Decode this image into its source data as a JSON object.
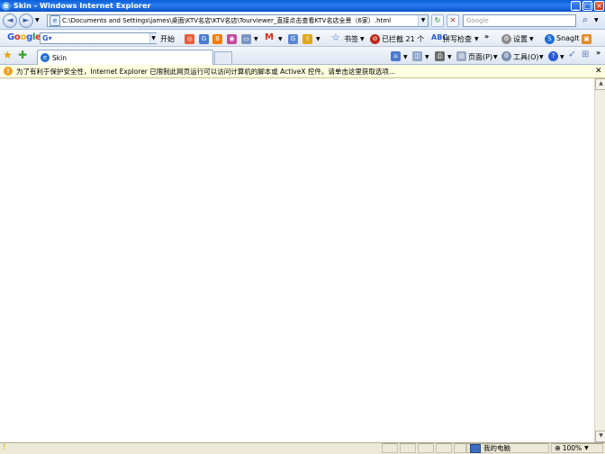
{
  "window": {
    "title": "Skin - Windows Internet Explorer",
    "controls": {
      "minimize": "_",
      "maximize": "□",
      "close": "×"
    }
  },
  "nav": {
    "back_icon": "◄",
    "forward_icon": "►",
    "address": "C:\\Documents and Settings\\james\\桌面\\KTV名店\\KTV名店\\Tourviewer_直接点击查看KTV名店全景（6家）.html",
    "search_placeholder": "Google",
    "refresh_icon": "↻",
    "stop_icon": "✕",
    "search_icon": "⌕"
  },
  "google_toolbar": {
    "logo": "Google",
    "go_label": "开始",
    "bookmarks_label": "书签",
    "blocked_label": "已拦截 21 个",
    "spellcheck_label": "拼写检查",
    "settings_label": "设置",
    "snagit_label": "SnagIt",
    "more": "»"
  },
  "tabs": {
    "active_title": "Skin"
  },
  "command_bar": {
    "page_label": "页面(P)",
    "tools_label": "工具(O)",
    "more": "»"
  },
  "infobar": {
    "message": "为了有利于保护安全性，Internet Explorer 已限制此网页运行可以访问计算机的脚本或 ActiveX 控件。请单击这里获取选项..."
  },
  "status": {
    "zone": "我的电脑",
    "zoom": "100%"
  },
  "colors": {
    "titlebar": "#0a5fd8",
    "infobar": "#ffffe1",
    "statusbar": "#ece9d8"
  }
}
